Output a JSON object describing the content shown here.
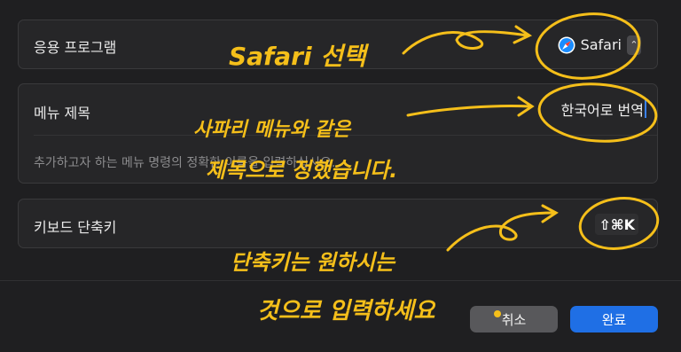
{
  "app_row": {
    "label": "응용 프로그램",
    "value": "Safari",
    "icon": "safari-compass-icon"
  },
  "menu_row": {
    "label": "메뉴 제목",
    "value": "한국어로 번역",
    "helper": "추가하고자 하는 메뉴 명령의 정확한 이름을 입력하십시오."
  },
  "shortcut_row": {
    "label": "키보드 단축키",
    "value": "⇧⌘K"
  },
  "buttons": {
    "cancel": "취소",
    "ok": "완료"
  },
  "annotations": {
    "safari_select": "Safari 선택",
    "menu_line1": "사파리 메뉴와 같은",
    "menu_line2": "제목으로 정했습니다.",
    "shortcut_line1": "단축키는 원하시는",
    "shortcut_line2": "것으로 입력하세요"
  },
  "colors": {
    "accent": "#1f6fe5",
    "annotation": "#f5bf1a",
    "background": "#1f1f21"
  }
}
